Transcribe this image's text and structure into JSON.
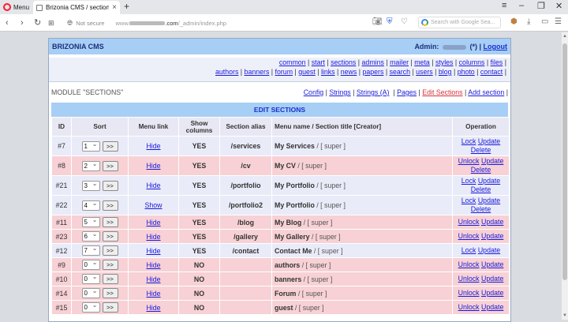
{
  "browser": {
    "menu_label": "Menu",
    "tab_title": "Brizonia CMS / sections",
    "new_tab": "+",
    "not_secure": "Not secure",
    "url_prefix": "www.",
    "url_mid": ".com",
    "url_path": "/_admin/index.php",
    "search_placeholder": "Search with Google Sea..."
  },
  "cms": {
    "brand": "BRIZONIA CMS",
    "admin_label": "Admin:",
    "admin_suffix": "(*) |",
    "logout": "Logout",
    "menu_row1": [
      "common",
      "start",
      "sections",
      "admins",
      "mailer",
      "meta",
      "styles",
      "columns",
      "files"
    ],
    "menu_row2": [
      "authors",
      "banners",
      "forum",
      "guest",
      "links",
      "news",
      "papers",
      "search",
      "users",
      "blog",
      "photo",
      "contact"
    ],
    "module_title": "MODULE \"SECTIONS\"",
    "module_links": {
      "config": "Config",
      "strings": "Strings",
      "strings_a": "Strings (A)",
      "pages": "Pages",
      "edit_sections": "Edit Sections",
      "add_section": "Add section"
    },
    "edit_header": "EDIT SECTIONS",
    "columns": {
      "id": "ID",
      "sort": "Sort",
      "menu_link": "Menu link",
      "show_columns": "Show columns",
      "section_alias": "Section alias",
      "title": "Menu name / Section title [Creator]",
      "operation": "Operation"
    },
    "go_label": ">>",
    "rows": [
      {
        "id": "#7",
        "sort": "1",
        "link": "Hide",
        "show": "YES",
        "alias": "/services",
        "title": "My Services",
        "creator": " / [ super ]",
        "op1": "Lock",
        "op2": "Update",
        "op3": "Delete"
      },
      {
        "id": "#8",
        "sort": "2",
        "link": "Hide",
        "show": "YES",
        "alias": "/cv",
        "title": "My CV",
        "creator": " / [ super ]",
        "op1": "Unlock",
        "op2": "Update",
        "op3": "Delete"
      },
      {
        "id": "#21",
        "sort": "3",
        "link": "Hide",
        "show": "YES",
        "alias": "/portfolio",
        "title": "My Portfolio",
        "creator": " / [ super ]",
        "op1": "Lock",
        "op2": "Update",
        "op3": "Delete"
      },
      {
        "id": "#22",
        "sort": "4",
        "link": "Show",
        "show": "YES",
        "alias": "/portfolio2",
        "title": "My Portfolio",
        "creator": " / [ super ]",
        "op1": "Lock",
        "op2": "Update",
        "op3": "Delete"
      },
      {
        "id": "#11",
        "sort": "5",
        "link": "Hide",
        "show": "YES",
        "alias": "/blog",
        "title": "My Blog",
        "creator": " / [ super ]",
        "op1": "Unlock",
        "op2": "Update",
        "op3": ""
      },
      {
        "id": "#23",
        "sort": "6",
        "link": "Hide",
        "show": "YES",
        "alias": "/gallery",
        "title": "My Gallery",
        "creator": " / [ super ]",
        "op1": "Unlock",
        "op2": "Update",
        "op3": ""
      },
      {
        "id": "#12",
        "sort": "7",
        "link": "Hide",
        "show": "YES",
        "alias": "/contact",
        "title": "Contact Me",
        "creator": " / [ super ]",
        "op1": "Lock",
        "op2": "Update",
        "op3": ""
      },
      {
        "id": "#9",
        "sort": "0",
        "link": "Hide",
        "show": "NO",
        "alias": "",
        "title": "authors",
        "creator": " / [ super ]",
        "op1": "Unlock",
        "op2": "Update",
        "op3": ""
      },
      {
        "id": "#10",
        "sort": "0",
        "link": "Hide",
        "show": "NO",
        "alias": "",
        "title": "banners",
        "creator": " / [ super ]",
        "op1": "Unlock",
        "op2": "Update",
        "op3": ""
      },
      {
        "id": "#14",
        "sort": "0",
        "link": "Hide",
        "show": "NO",
        "alias": "",
        "title": "Forum",
        "creator": " / [ super ]",
        "op1": "Unlock",
        "op2": "Update",
        "op3": ""
      },
      {
        "id": "#15",
        "sort": "0",
        "link": "Hide",
        "show": "NO",
        "alias": "",
        "title": "guest",
        "creator": " / [ super ]",
        "op1": "Unlock",
        "op2": "Update",
        "op3": ""
      }
    ]
  },
  "colors": {
    "header_blue": "#a7cef5",
    "row_blue": "#e9ebf8",
    "row_pink": "#f7d1d5",
    "link_blue": "#1a1adb",
    "active_red": "#d8323c"
  }
}
